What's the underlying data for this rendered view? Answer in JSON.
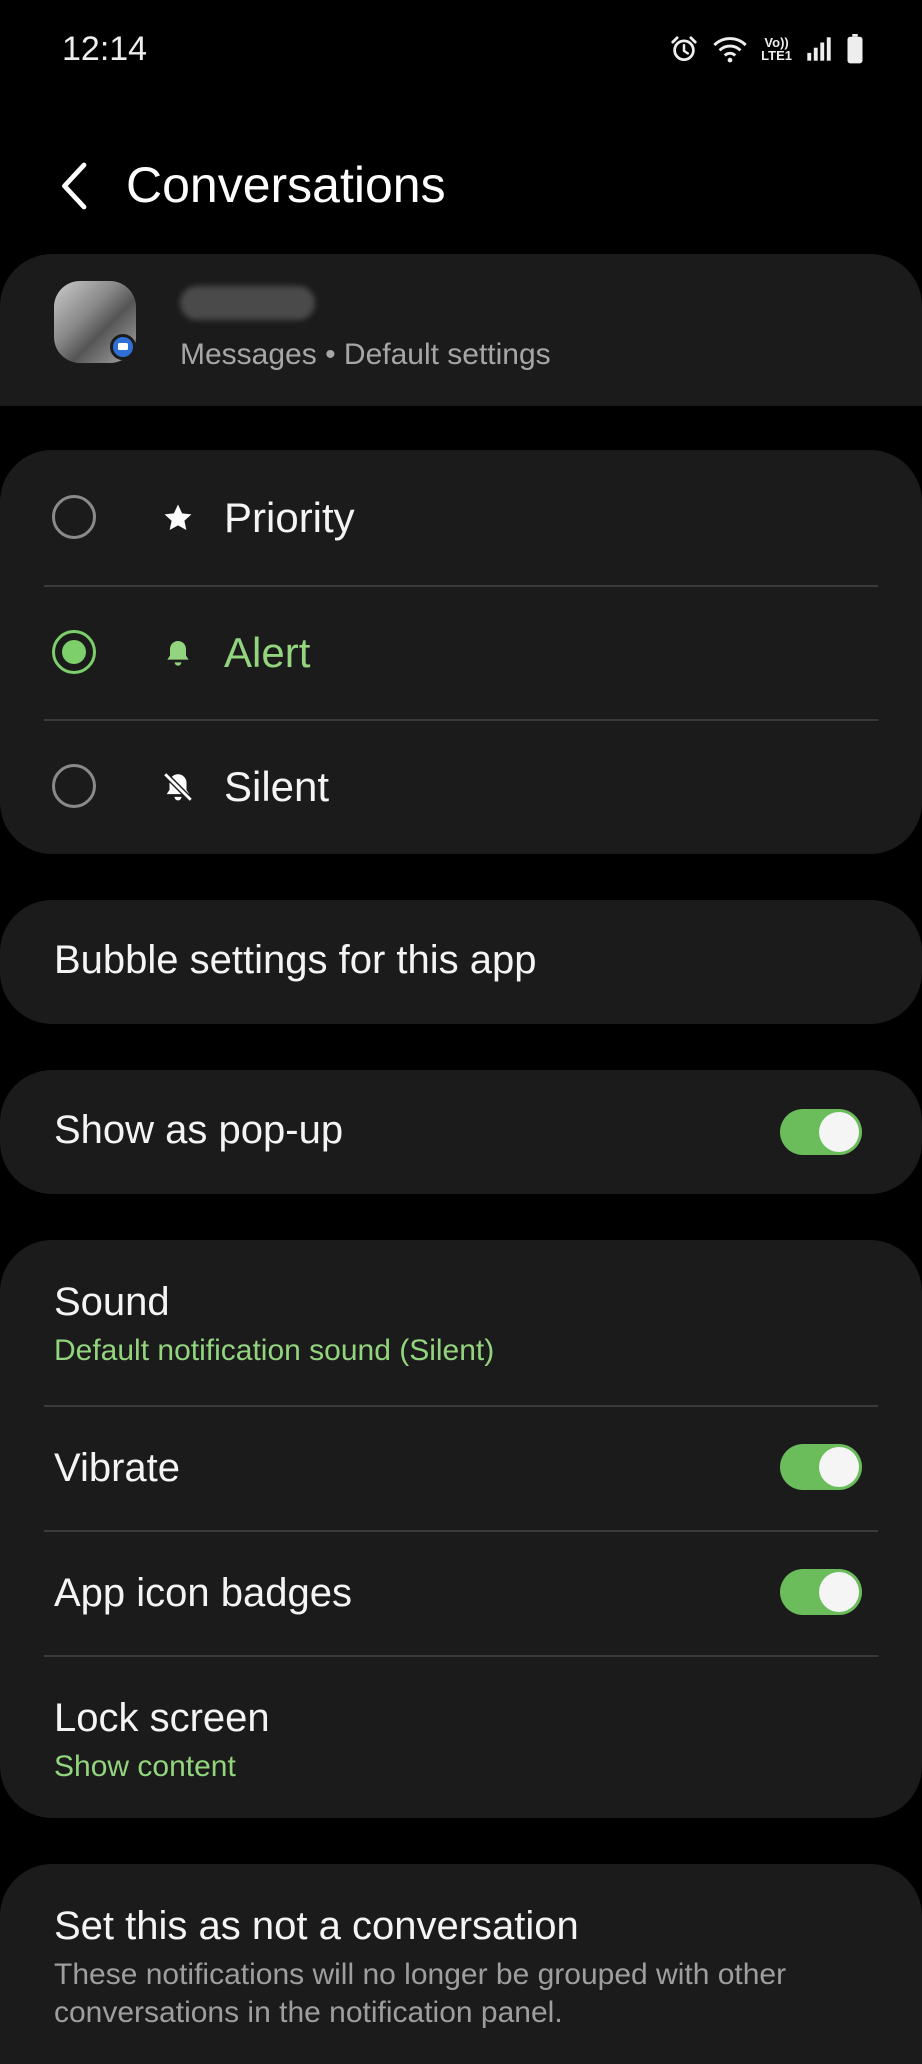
{
  "status_bar": {
    "time": "12:14",
    "network_label_top": "Vo))",
    "network_label_bottom": "LTE1"
  },
  "header": {
    "title": "Conversations",
    "back_icon": "chevron-left-icon"
  },
  "conversation": {
    "contact_name": "",
    "subtitle": "Messages • Default settings"
  },
  "priority_options": [
    {
      "label": "Priority",
      "icon": "star-icon",
      "selected": false
    },
    {
      "label": "Alert",
      "icon": "bell-icon",
      "selected": true
    },
    {
      "label": "Silent",
      "icon": "bell-off-icon",
      "selected": false
    }
  ],
  "bubble_settings": {
    "label": "Bubble settings for this app"
  },
  "popup": {
    "label": "Show as pop-up",
    "enabled": true
  },
  "settings": {
    "sound": {
      "label": "Sound",
      "value": "Default notification sound (Silent)"
    },
    "vibrate": {
      "label": "Vibrate",
      "enabled": true
    },
    "app_icon_badges": {
      "label": "App icon badges",
      "enabled": true
    },
    "lock_screen": {
      "label": "Lock screen",
      "value": "Show content"
    }
  },
  "not_conversation": {
    "title": "Set this as not a conversation",
    "description": "These notifications will no longer be grouped with other conversations in the notification panel."
  },
  "colors": {
    "accent": "#7ccf6a",
    "card": "#1b1b1b",
    "background": "#000000"
  }
}
